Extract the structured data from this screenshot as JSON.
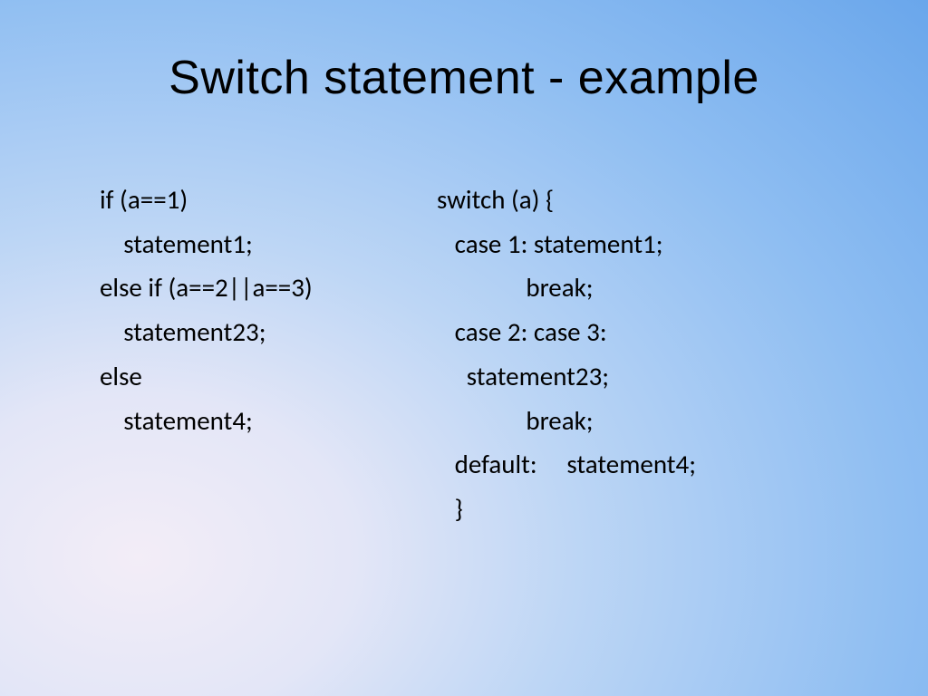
{
  "slide": {
    "title": "Switch statement - example",
    "left_code": "if (a==1)\n    statement1;\nelse if (a==2||a==3)\n    statement23;\nelse\n    statement4;",
    "right_code": "switch (a) {\n   case 1: statement1;\n               break;\n   case 2: case 3:\n     statement23;\n               break;\n   default:     statement4;\n   }"
  }
}
